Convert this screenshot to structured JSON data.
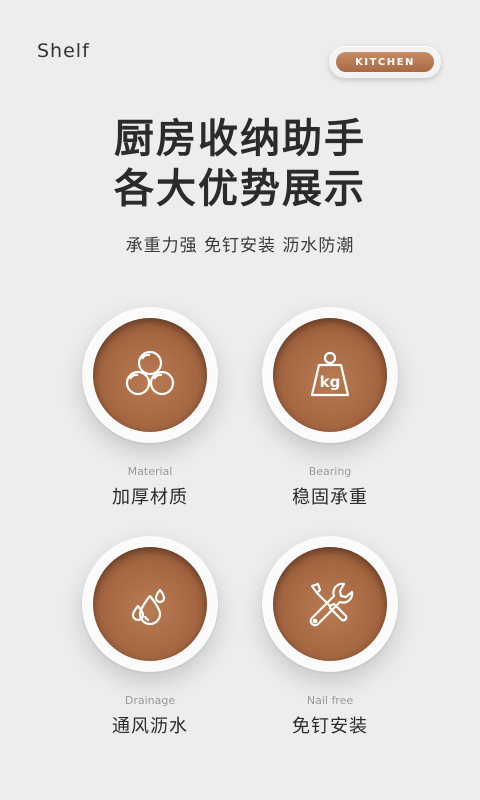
{
  "header": {
    "brand": "Shelf",
    "badge": "KITCHEN"
  },
  "hero": {
    "title_line1": "厨房收纳助手",
    "title_line2": "各大优势展示",
    "subtitle": "承重力强 免钉安装 沥水防潮"
  },
  "features": [
    {
      "en": "Material",
      "cn": "加厚材质",
      "icon": "spheres-icon"
    },
    {
      "en": "Bearing",
      "cn": "稳固承重",
      "icon": "kg-weight-icon"
    },
    {
      "en": "Drainage",
      "cn": "通风沥水",
      "icon": "water-drops-icon"
    },
    {
      "en": "Nail free",
      "cn": "免钉安装",
      "icon": "tools-icon"
    }
  ],
  "colors": {
    "accent": "#a56742",
    "background": "#ededed"
  }
}
